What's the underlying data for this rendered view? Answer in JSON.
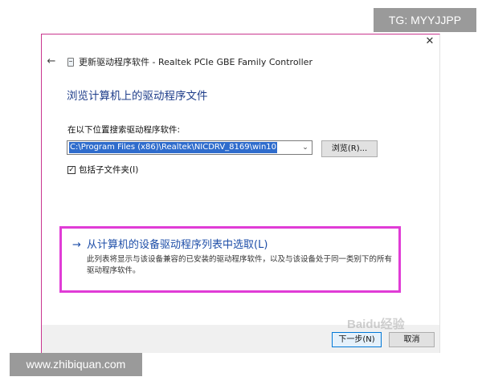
{
  "window": {
    "title": "更新驱动程序软件 - Realtek PCIe GBE Family Controller",
    "close_glyph": "✕",
    "back_glyph": "←"
  },
  "main": {
    "heading": "浏览计算机上的驱动程序文件",
    "search_label": "在以下位置搜索驱动程序软件:",
    "path_value": "C:\\Program Files (x86)\\Realtek\\NICDRV_8169\\win10",
    "combo_arrow_glyph": "⌄",
    "browse_button": "浏览(R)...",
    "include_subfolders_label": "包括子文件夹(I)",
    "include_subfolders_checked": true,
    "check_glyph": "✓"
  },
  "pick_option": {
    "arrow_glyph": "→",
    "title": "从计算机的设备驱动程序列表中选取(L)",
    "description": "此列表将显示与该设备兼容的已安装的驱动程序软件，以及与该设备处于同一类别下的所有驱动程序软件。"
  },
  "footer": {
    "next_button": "下一步(N)",
    "cancel_button": "取消"
  },
  "watermarks": {
    "tg": "TG: MYYJJPP",
    "site": "www.zhibiquan.com",
    "baidu": "Baidu经验"
  },
  "colors": {
    "heading_blue": "#1e3d8a",
    "link_blue": "#1e4ea8",
    "selection_blue": "#2f6ccc",
    "highlight_magenta": "#e03cd6",
    "footer_bg": "#f0f0f0"
  }
}
